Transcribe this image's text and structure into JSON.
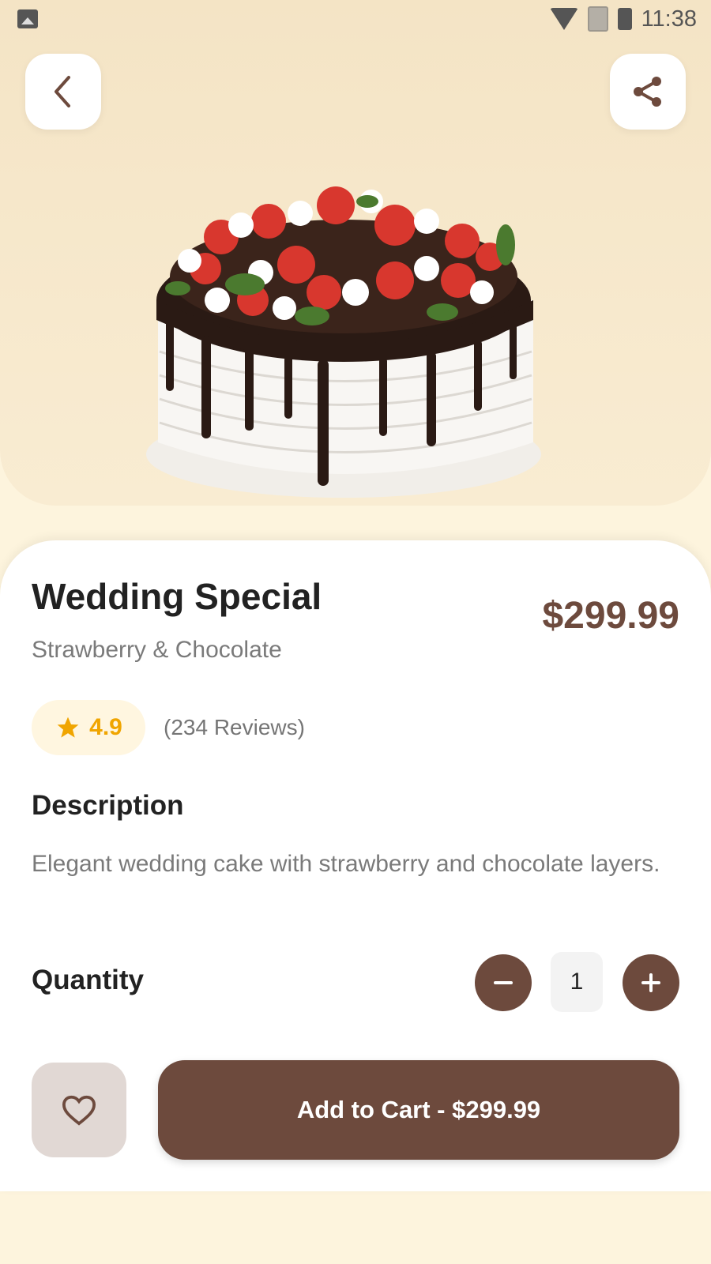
{
  "status_bar": {
    "time": "11:38"
  },
  "product": {
    "title": "Wedding Special",
    "subtitle": "Strawberry & Chocolate",
    "price": "$299.99",
    "rating": "4.9",
    "reviews": "(234 Reviews)",
    "image_alt": "chocolate drip strawberry cake"
  },
  "description": {
    "heading": "Description",
    "text": "Elegant wedding cake with strawberry and chocolate layers."
  },
  "quantity": {
    "label": "Quantity",
    "value": "1"
  },
  "actions": {
    "add_to_cart": "Add to Cart - $299.99"
  },
  "colors": {
    "accent": "#6d4a3d",
    "star": "#f0a500",
    "hero_bg": "#f4e4c5"
  },
  "icons": [
    "back-arrow-icon",
    "share-icon",
    "star-icon",
    "minus-icon",
    "plus-icon",
    "heart-icon"
  ]
}
